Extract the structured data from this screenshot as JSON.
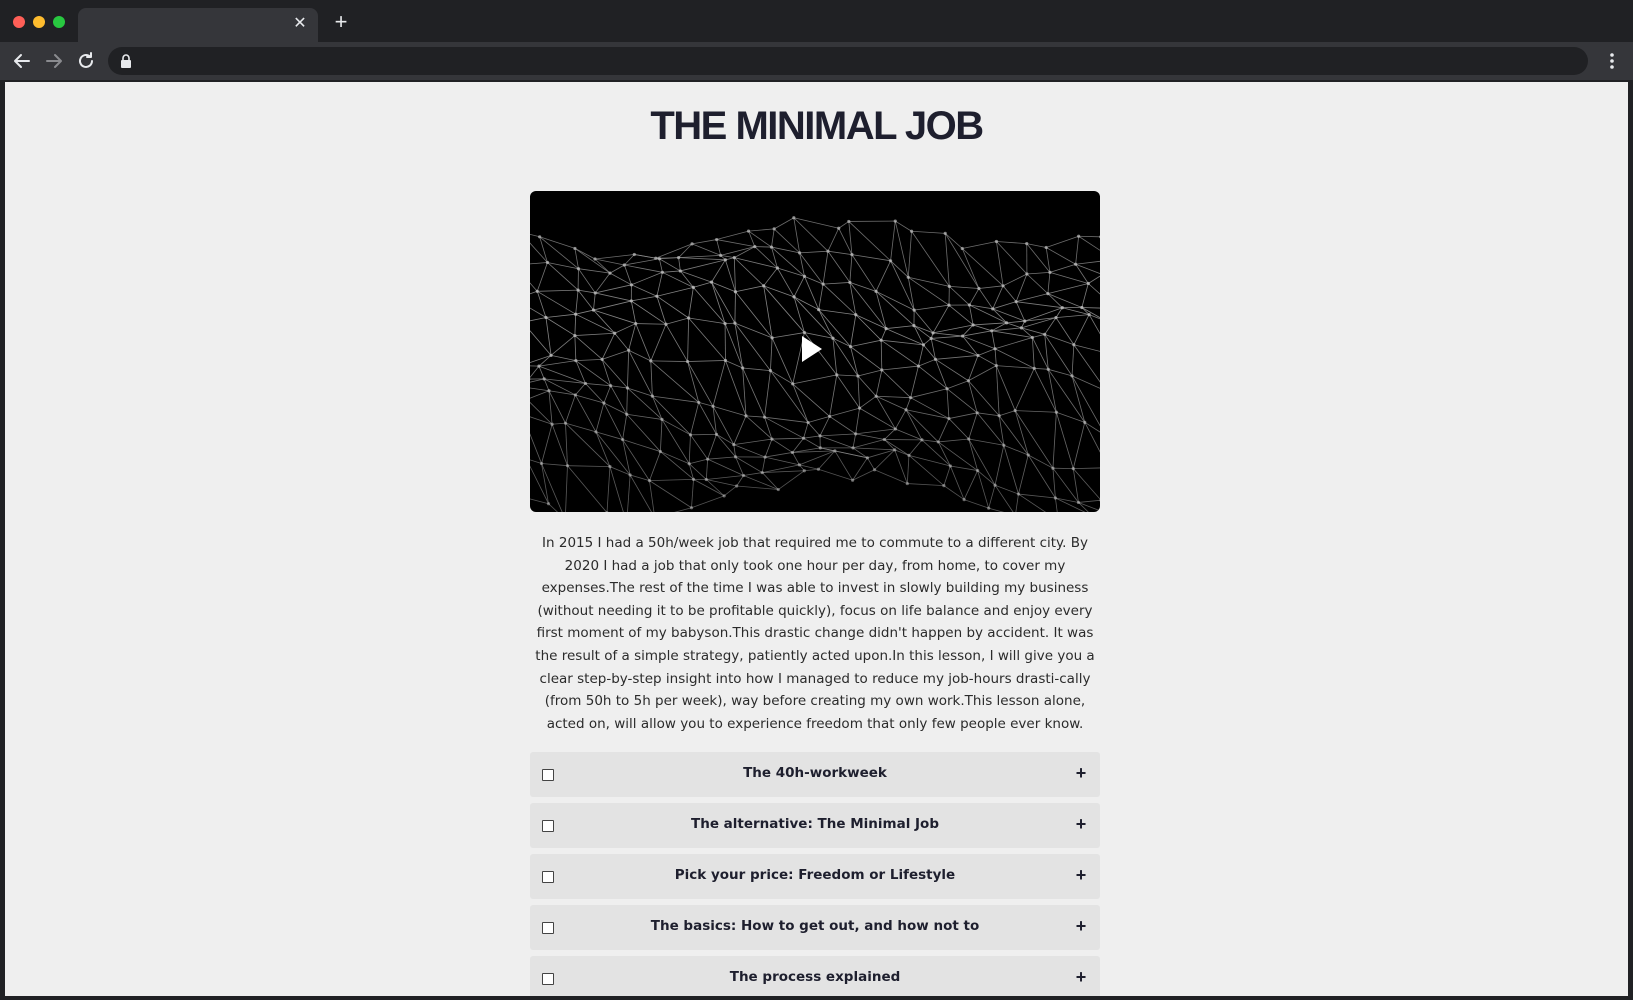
{
  "browser": {
    "tab": {
      "title": "",
      "close_icon": "close-icon"
    },
    "new_tab_icon": "plus-icon",
    "address_bar": {
      "url": "",
      "lock_icon": "lock-icon"
    }
  },
  "page": {
    "title": "THE MINIMAL JOB",
    "video": {
      "play_icon": "play-icon"
    },
    "description": "In 2015 I had a 50h/week job that required me to commute to a different city. By 2020 I had a job that only took one hour per day, from home, to cover my expenses.The rest of the time I was able to invest in slowly building my business (without needing it to be profitable quickly), focus on life balance and enjoy every first moment of my babyson.This drastic change didn't happen by accident. It was the result of a simple strategy, patiently acted upon.In this lesson, I will give you a clear step-by-step insight into how I managed to reduce my job-hours drasti-cally (from 50h to 5h per week), way before creating my own work.This lesson alone, acted on, will allow you to experience freedom that only few people ever know.",
    "lessons": [
      {
        "label": "The 40h-workweek",
        "toggle": "+"
      },
      {
        "label": "The alternative: The Minimal Job",
        "toggle": "+"
      },
      {
        "label": "Pick your price: Freedom or Lifestyle",
        "toggle": "+"
      },
      {
        "label": "The basics: How to get out, and how not to",
        "toggle": "+"
      },
      {
        "label": "The process explained",
        "toggle": "+"
      }
    ]
  },
  "colors": {
    "chrome_dark": "#202124",
    "chrome_toolbar": "#35363a",
    "page_bg": "#efefef",
    "title": "#1e1f2e",
    "accordion_bg": "#e3e3e3"
  }
}
